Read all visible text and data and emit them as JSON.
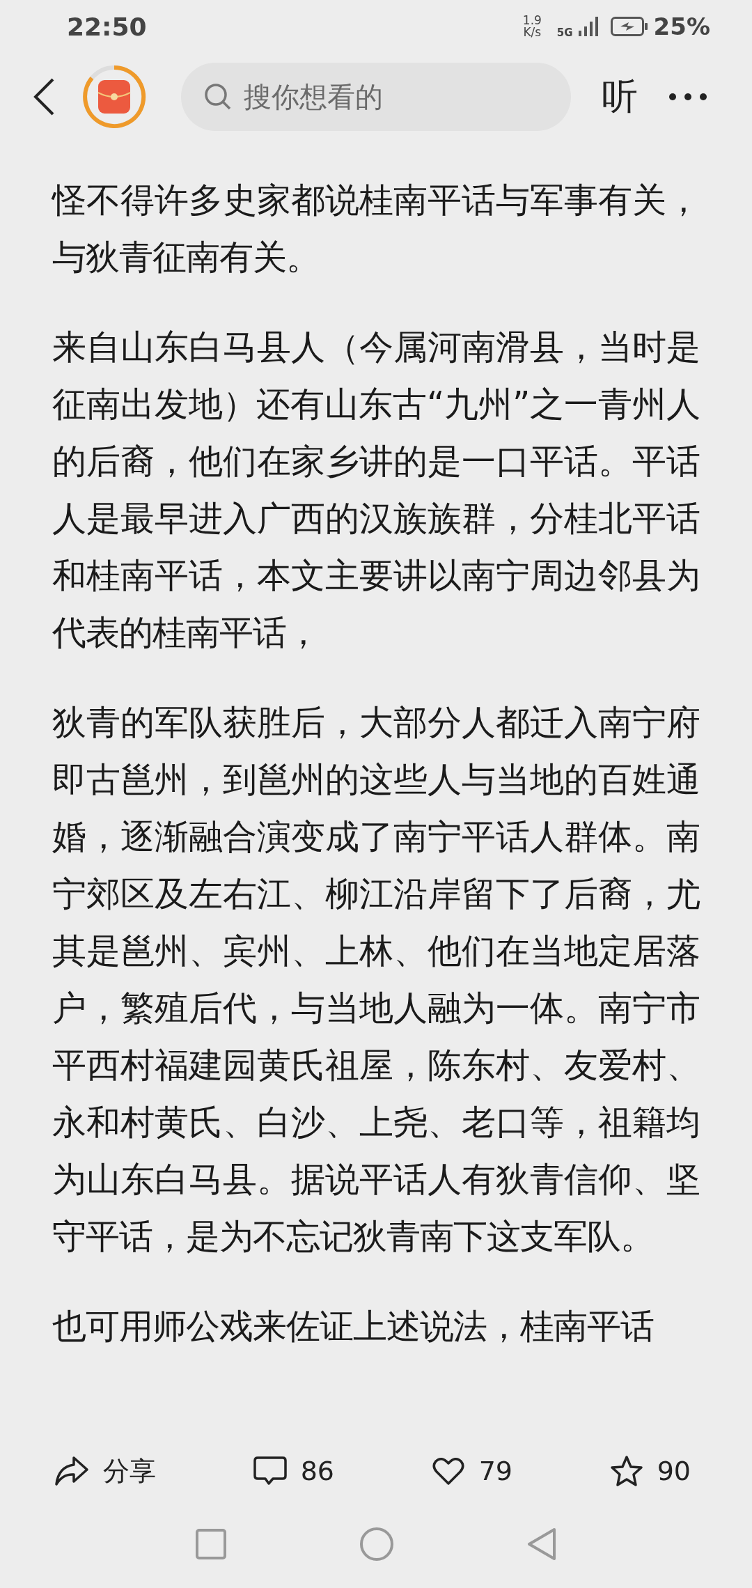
{
  "status_bar": {
    "time": "22:50",
    "net_speed_value": "1.9",
    "net_speed_unit": "K/s",
    "network": "5G",
    "battery": "25%"
  },
  "header": {
    "search": {
      "placeholder": "搜你想看的"
    },
    "listen": "听"
  },
  "article": {
    "paragraphs": [
      "怪不得许多史家都说桂南平话与军事有关，与狄青征南有关。",
      "来自山东白马县人（今属河南滑县，当时是征南出发地）还有山东古“九州”之一青州人的后裔，他们在家乡讲的是一口平话。平话人是最早进入广西的汉族族群，分桂北平话和桂南平话，本文主要讲以南宁周边邻县为代表的桂南平话，",
      "狄青的军队获胜后，大部分人都迁入南宁府即古邕州，到邕州的这些人与当地的百姓通婚，逐渐融合演变成了南宁平话人群体。南宁郊区及左右江、柳江沿岸留下了后裔，尤其是邕州、宾州、上林、他们在当地定居落户，繁殖后代，与当地人融为一体。南宁市平西村福建园黄氏祖屋，陈东村、友爱村、永和村黄氏、白沙、上尧、老口等，祖籍均为山东白马县。据说平话人有狄青信仰、坚守平话，是为不忘记狄青南下这支军队。",
      "也可用师公戏来佐证上述说法，桂南平话"
    ]
  },
  "actions": [
    {
      "kind": "share",
      "label": "分享"
    },
    {
      "kind": "comment",
      "label": "86"
    },
    {
      "kind": "like",
      "label": "79"
    },
    {
      "kind": "favorite",
      "label": "90"
    }
  ]
}
